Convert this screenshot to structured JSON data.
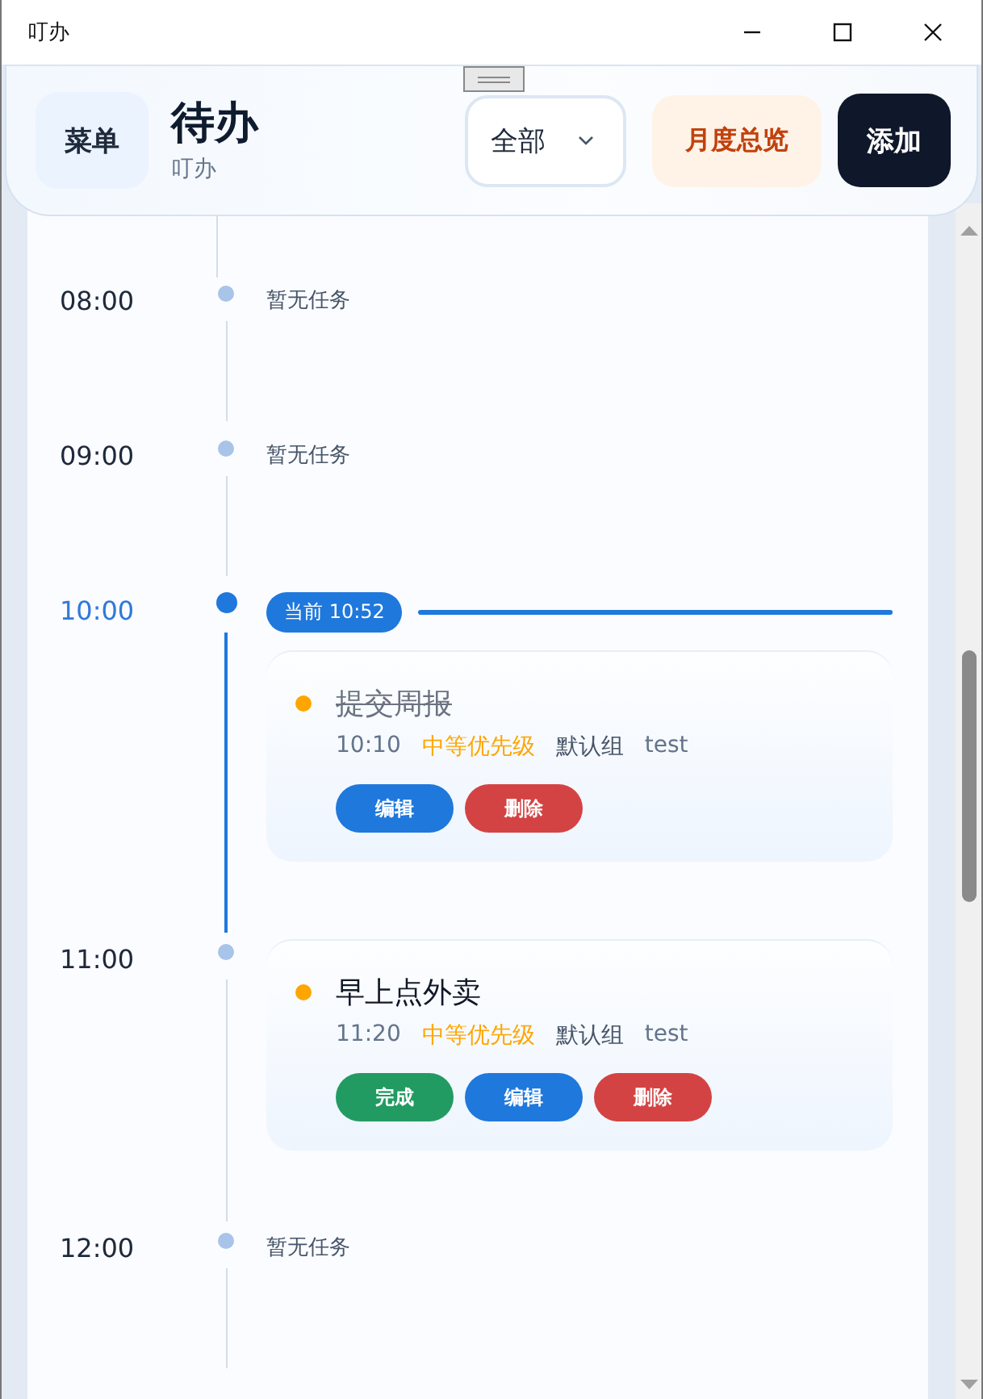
{
  "window": {
    "title": "叮办"
  },
  "header": {
    "menu_button": "菜单",
    "title": "待办",
    "subtitle": "叮办",
    "filter": {
      "value": "全部"
    },
    "month_button": "月度总览",
    "add_button": "添加"
  },
  "timeline": [
    {
      "time": "08:00",
      "current": false,
      "empty_text": "暂无任务"
    },
    {
      "time": "09:00",
      "current": false,
      "empty_text": "暂无任务"
    },
    {
      "time": "10:00",
      "current": true,
      "now_label": "当前 10:52",
      "tasks": [
        {
          "title": "提交周报",
          "done": true,
          "time": "10:10",
          "priority": "中等优先级",
          "color": "#ffa500",
          "group": "默认组",
          "tag": "test",
          "buttons": [
            {
              "label": "编辑",
              "kind": "edit"
            },
            {
              "label": "删除",
              "kind": "delete"
            }
          ]
        }
      ]
    },
    {
      "time": "11:00",
      "current": false,
      "tasks": [
        {
          "title": "早上点外卖",
          "done": false,
          "time": "11:20",
          "priority": "中等优先级",
          "color": "#ffa500",
          "group": "默认组",
          "tag": "test",
          "buttons": [
            {
              "label": "完成",
              "kind": "complete"
            },
            {
              "label": "编辑",
              "kind": "edit"
            },
            {
              "label": "删除",
              "kind": "delete"
            }
          ]
        }
      ]
    },
    {
      "time": "12:00",
      "current": false,
      "empty_text": "暂无任务"
    }
  ]
}
